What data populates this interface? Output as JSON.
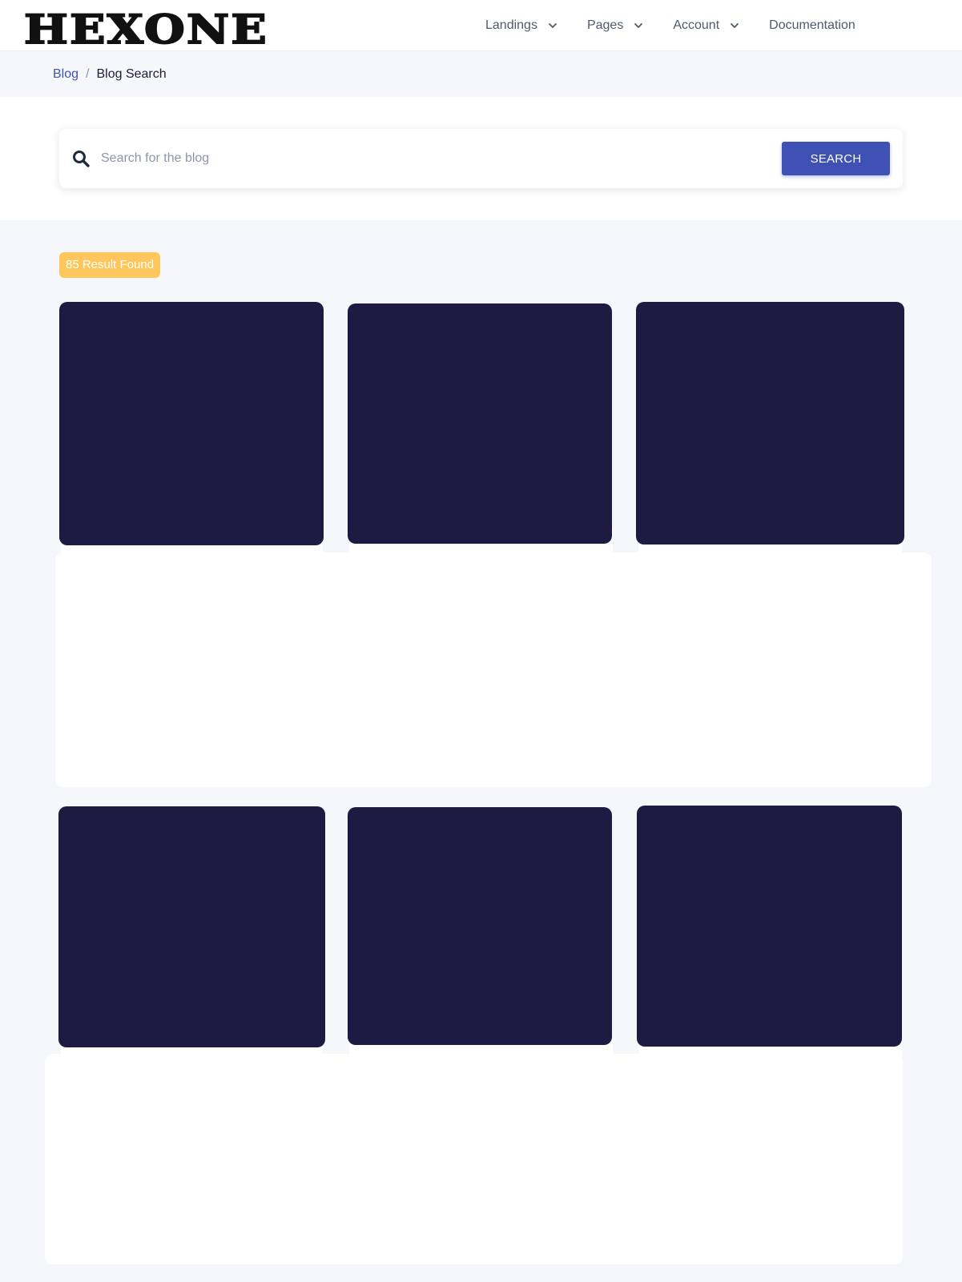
{
  "brand": {
    "logo_text": "HEXONE"
  },
  "nav": {
    "items": [
      {
        "label": "Landings",
        "has_dropdown": true
      },
      {
        "label": "Pages",
        "has_dropdown": true
      },
      {
        "label": "Account",
        "has_dropdown": true
      },
      {
        "label": "Documentation",
        "has_dropdown": false
      }
    ]
  },
  "breadcrumb": {
    "parent": "Blog",
    "separator": "/",
    "current": "Blog Search"
  },
  "search": {
    "placeholder": "Search for the blog",
    "value": "",
    "button_label": "SEARCH",
    "icon": "search-icon"
  },
  "results": {
    "badge_text": "85 Result Found"
  },
  "colors": {
    "accent": "#3f51b5",
    "badge": "#ffc65c",
    "card_image": "#1d1b42",
    "page_bg": "#f6f7fa"
  }
}
